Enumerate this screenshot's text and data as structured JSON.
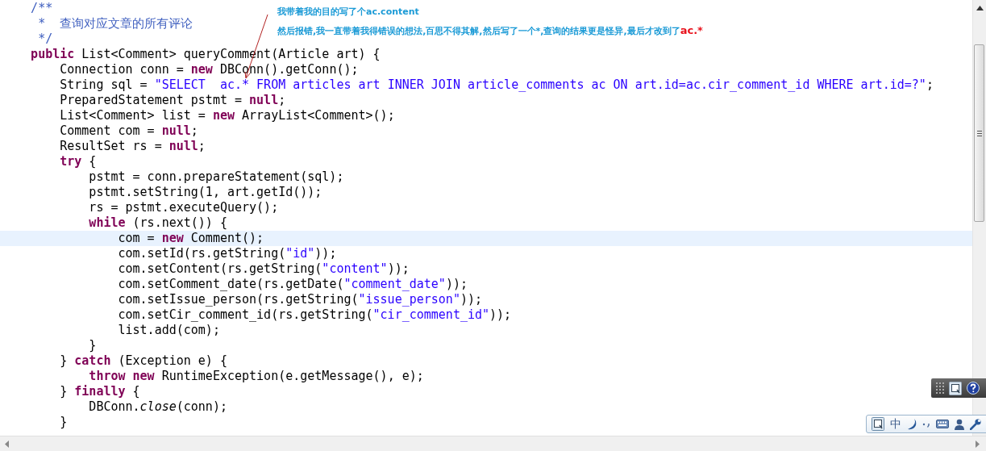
{
  "editor": {
    "lines": [
      {
        "current": false,
        "tokens": [
          {
            "kind": "comment",
            "text": "    /**"
          }
        ]
      },
      {
        "current": false,
        "tokens": [
          {
            "kind": "comment",
            "text": "     *  查询对应文章的所有评论"
          }
        ]
      },
      {
        "current": false,
        "tokens": [
          {
            "kind": "comment",
            "text": "     */"
          }
        ]
      },
      {
        "current": false,
        "tokens": [
          {
            "kind": "keyword",
            "text": "    public"
          },
          {
            "kind": "plain",
            "text": " List<Comment> queryComment(Article art) {"
          }
        ]
      },
      {
        "current": false,
        "tokens": [
          {
            "kind": "plain",
            "text": "        Connection conn = "
          },
          {
            "kind": "keyword",
            "text": "new"
          },
          {
            "kind": "plain",
            "text": " DBConn().getConn();"
          }
        ]
      },
      {
        "current": false,
        "tokens": [
          {
            "kind": "plain",
            "text": "        String sql = "
          },
          {
            "kind": "string",
            "text": "\"SELECT  ac.* FROM articles art INNER JOIN article_comments ac ON art.id=ac.cir_comment_id WHERE art.id=?\""
          },
          {
            "kind": "plain",
            "text": ";"
          }
        ]
      },
      {
        "current": false,
        "tokens": [
          {
            "kind": "plain",
            "text": "        PreparedStatement pstmt = "
          },
          {
            "kind": "keyword",
            "text": "null"
          },
          {
            "kind": "plain",
            "text": ";"
          }
        ]
      },
      {
        "current": false,
        "tokens": [
          {
            "kind": "plain",
            "text": "        List<Comment> list = "
          },
          {
            "kind": "keyword",
            "text": "new"
          },
          {
            "kind": "plain",
            "text": " ArrayList<Comment>();"
          }
        ]
      },
      {
        "current": false,
        "tokens": [
          {
            "kind": "plain",
            "text": "        Comment com = "
          },
          {
            "kind": "keyword",
            "text": "null"
          },
          {
            "kind": "plain",
            "text": ";"
          }
        ]
      },
      {
        "current": false,
        "tokens": [
          {
            "kind": "plain",
            "text": "        ResultSet rs = "
          },
          {
            "kind": "keyword",
            "text": "null"
          },
          {
            "kind": "plain",
            "text": ";"
          }
        ]
      },
      {
        "current": false,
        "tokens": [
          {
            "kind": "keyword",
            "text": "        try"
          },
          {
            "kind": "plain",
            "text": " {"
          }
        ]
      },
      {
        "current": false,
        "tokens": [
          {
            "kind": "plain",
            "text": "            pstmt = conn.prepareStatement(sql);"
          }
        ]
      },
      {
        "current": false,
        "tokens": [
          {
            "kind": "plain",
            "text": "            pstmt.setString(1, art.getId());"
          }
        ]
      },
      {
        "current": false,
        "tokens": [
          {
            "kind": "plain",
            "text": "            rs = pstmt.executeQuery();"
          }
        ]
      },
      {
        "current": false,
        "tokens": [
          {
            "kind": "keyword",
            "text": "            while"
          },
          {
            "kind": "plain",
            "text": " (rs.next()) {"
          }
        ]
      },
      {
        "current": true,
        "tokens": [
          {
            "kind": "plain",
            "text": "                com = "
          },
          {
            "kind": "keyword",
            "text": "new"
          },
          {
            "kind": "plain",
            "text": " Comment();"
          }
        ]
      },
      {
        "current": false,
        "tokens": [
          {
            "kind": "plain",
            "text": "                com.setId(rs.getString("
          },
          {
            "kind": "string",
            "text": "\"id\""
          },
          {
            "kind": "plain",
            "text": "));"
          }
        ]
      },
      {
        "current": false,
        "tokens": [
          {
            "kind": "plain",
            "text": "                com.setContent(rs.getString("
          },
          {
            "kind": "string",
            "text": "\"content\""
          },
          {
            "kind": "plain",
            "text": "));"
          }
        ]
      },
      {
        "current": false,
        "tokens": [
          {
            "kind": "plain",
            "text": "                com.setComment_date(rs.getDate("
          },
          {
            "kind": "string",
            "text": "\"comment_date\""
          },
          {
            "kind": "plain",
            "text": "));"
          }
        ]
      },
      {
        "current": false,
        "tokens": [
          {
            "kind": "plain",
            "text": "                com.setIssue_person(rs.getString("
          },
          {
            "kind": "string",
            "text": "\"issue_person\""
          },
          {
            "kind": "plain",
            "text": "));"
          }
        ]
      },
      {
        "current": false,
        "tokens": [
          {
            "kind": "plain",
            "text": "                com.setCir_comment_id(rs.getString("
          },
          {
            "kind": "string",
            "text": "\"cir_comment_id\""
          },
          {
            "kind": "plain",
            "text": "));"
          }
        ]
      },
      {
        "current": false,
        "tokens": [
          {
            "kind": "plain",
            "text": "                list.add(com);"
          }
        ]
      },
      {
        "current": false,
        "tokens": [
          {
            "kind": "plain",
            "text": "            }"
          }
        ]
      },
      {
        "current": false,
        "tokens": [
          {
            "kind": "plain",
            "text": "        } "
          },
          {
            "kind": "keyword",
            "text": "catch"
          },
          {
            "kind": "plain",
            "text": " (Exception e) {"
          }
        ]
      },
      {
        "current": false,
        "tokens": [
          {
            "kind": "keyword",
            "text": "            throw new"
          },
          {
            "kind": "plain",
            "text": " RuntimeException(e.getMessage(), e);"
          }
        ]
      },
      {
        "current": false,
        "tokens": [
          {
            "kind": "plain",
            "text": "        } "
          },
          {
            "kind": "keyword",
            "text": "finally"
          },
          {
            "kind": "plain",
            "text": " {"
          }
        ]
      },
      {
        "current": false,
        "tokens": [
          {
            "kind": "plain",
            "text": "            DBConn."
          },
          {
            "kind": "italic",
            "text": "close"
          },
          {
            "kind": "plain",
            "text": "(conn);"
          }
        ]
      },
      {
        "current": false,
        "tokens": [
          {
            "kind": "plain",
            "text": "        }"
          }
        ]
      }
    ]
  },
  "annotations": [
    {
      "segments": [
        {
          "text": "我带着我的目的写了个ac.content",
          "emphasis": false
        }
      ]
    },
    {
      "segments": [
        {
          "text": "然后报错,我一直带着我得错误的想法,百思不得其解,然后写了一个*,查询的结果更是怪异,最后才改到了",
          "emphasis": false
        },
        {
          "text": "ac.*",
          "emphasis": true
        }
      ]
    }
  ],
  "ime_bar": {
    "label": "中"
  }
}
